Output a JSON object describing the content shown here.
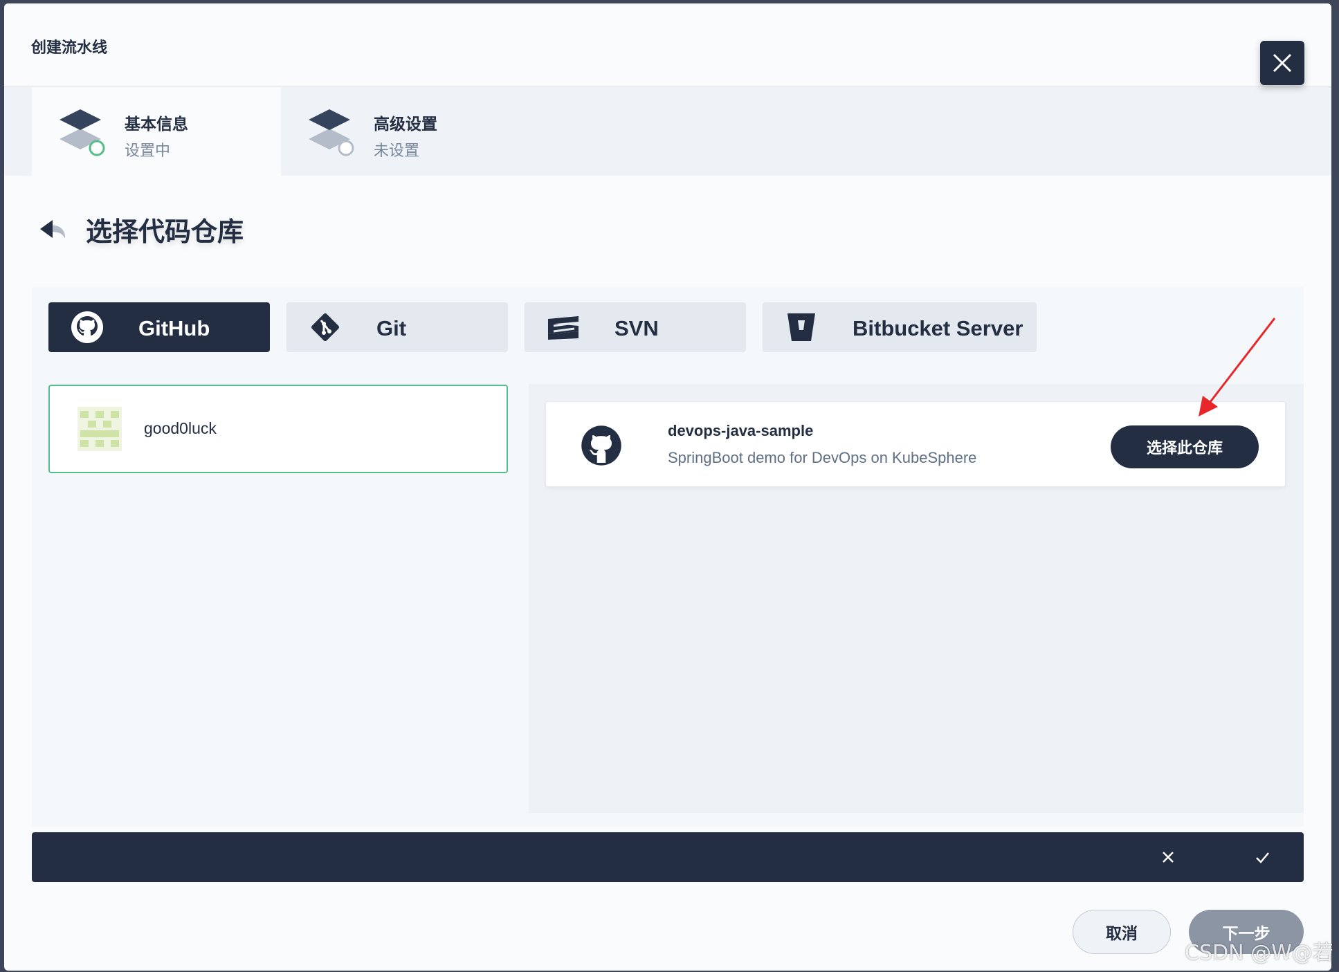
{
  "modal": {
    "title": "创建流水线"
  },
  "steps": [
    {
      "title": "基本信息",
      "status": "设置中",
      "state": "active"
    },
    {
      "title": "高级设置",
      "status": "未设置",
      "state": "pending"
    }
  ],
  "section": {
    "title": "选择代码仓库"
  },
  "repo_types": [
    {
      "label": "GitHub",
      "icon": "github-icon",
      "active": true
    },
    {
      "label": "Git",
      "icon": "git-icon",
      "active": false
    },
    {
      "label": "SVN",
      "icon": "svn-icon",
      "active": false
    },
    {
      "label": "Bitbucket Server",
      "icon": "bitbucket-icon",
      "active": false
    }
  ],
  "account": {
    "name": "good0luck"
  },
  "repos": [
    {
      "name": "devops-java-sample",
      "description": "SpringBoot demo for DevOps on KubeSphere",
      "action_label": "选择此仓库"
    }
  ],
  "footer": {
    "cancel_label": "取消",
    "next_label": "下一步"
  },
  "watermark": "CSDN @W@若",
  "colors": {
    "primary_dark": "#242e42",
    "success_green": "#55bc8a",
    "annotation_red": "#e8262a"
  }
}
